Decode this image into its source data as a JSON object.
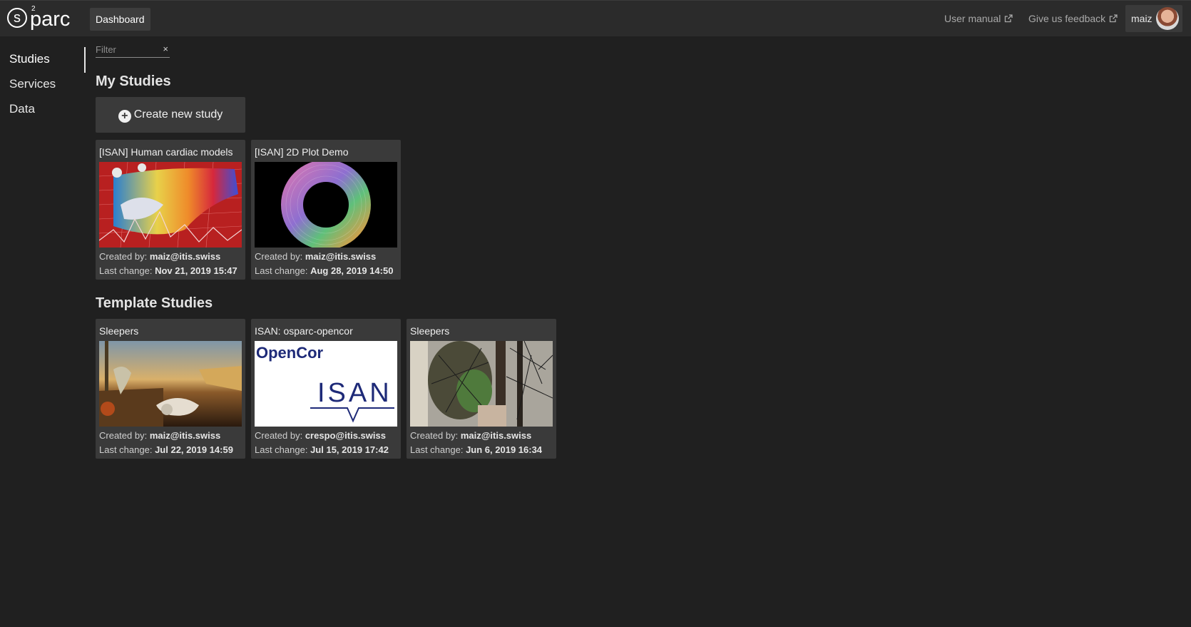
{
  "header": {
    "logo_text": "parc",
    "logo_letter": "s",
    "logo_superscript": "2",
    "dashboard_label": "Dashboard",
    "user_manual_label": "User manual",
    "feedback_label": "Give us feedback",
    "user_name": "maiz"
  },
  "sidebar": {
    "items": [
      {
        "label": "Studies"
      },
      {
        "label": "Services"
      },
      {
        "label": "Data"
      }
    ]
  },
  "filter": {
    "placeholder": "Filter",
    "clear_icon": "×"
  },
  "my_studies": {
    "title": "My Studies",
    "create_label": "Create new study",
    "cards": [
      {
        "title": "[ISAN] Human cardiac models",
        "created_prefix": "Created by:",
        "created_by": "maiz@itis.swiss",
        "changed_prefix": "Last change:",
        "last_change": "Nov 21, 2019 15:47"
      },
      {
        "title": "[ISAN] 2D Plot Demo",
        "created_prefix": "Created by:",
        "created_by": "maiz@itis.swiss",
        "changed_prefix": "Last change:",
        "last_change": "Aug 28, 2019 14:50"
      }
    ]
  },
  "template_studies": {
    "title": "Template Studies",
    "cards": [
      {
        "title": "Sleepers",
        "created_prefix": "Created by:",
        "created_by": "maiz@itis.swiss",
        "changed_prefix": "Last change:",
        "last_change": "Jul 22, 2019 14:59"
      },
      {
        "title": "ISAN: osparc-opencor",
        "created_prefix": "Created by:",
        "created_by": "crespo@itis.swiss",
        "changed_prefix": "Last change:",
        "last_change": "Jul 15, 2019 17:42",
        "thumb_title": "OpenCor",
        "thumb_logo": "ISAN"
      },
      {
        "title": "Sleepers",
        "created_prefix": "Created by:",
        "created_by": "maiz@itis.swiss",
        "changed_prefix": "Last change:",
        "last_change": "Jun 6, 2019 16:34"
      }
    ]
  },
  "icons": {
    "external_link": "external-link-icon",
    "plus": "plus-circle-icon",
    "close": "close-icon"
  }
}
